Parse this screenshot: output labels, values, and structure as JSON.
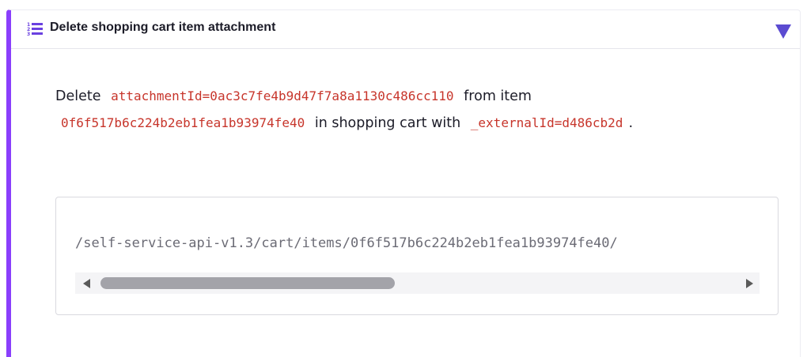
{
  "section": {
    "title": "Delete shopping cart item attachment",
    "title_icon": "numbered-list-icon",
    "toggle_icon": "chevron-down-icon",
    "accent_color": "#8a3ffc"
  },
  "description": {
    "t1": "Delete",
    "attachment": "attachmentId=0ac3c7fe4b9d47f7a8a1130c486cc110",
    "t2": "from item",
    "item": "0f6f517b6c224b2eb1fea1b93974fe40",
    "t3": "in shopping cart with",
    "external": "_externalId=d486cb2d",
    "t4": "."
  },
  "code": {
    "path": "/self-service-api-v1.3/cart/items/0f6f517b6c224b2eb1fea1b93974fe40/"
  }
}
